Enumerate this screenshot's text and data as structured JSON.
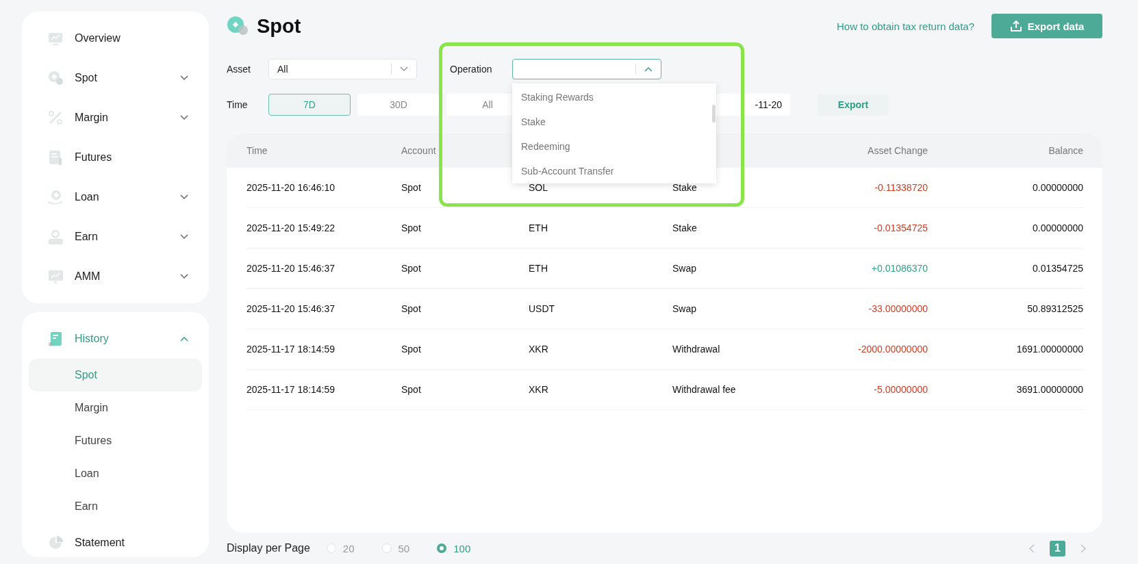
{
  "sidebar": {
    "groups": [
      {
        "items": [
          {
            "label": "Overview",
            "kind": "link",
            "active": false
          },
          {
            "label": "Spot",
            "kind": "menu",
            "expanded": false,
            "active": false
          },
          {
            "label": "Margin",
            "kind": "menu",
            "expanded": false,
            "active": false
          },
          {
            "label": "Futures",
            "kind": "link",
            "active": false
          },
          {
            "label": "Loan",
            "kind": "menu",
            "expanded": false,
            "active": false
          },
          {
            "label": "Earn",
            "kind": "menu",
            "expanded": false,
            "active": false
          },
          {
            "label": "AMM",
            "kind": "menu",
            "expanded": false,
            "active": false
          }
        ]
      },
      {
        "items": [
          {
            "label": "History",
            "kind": "menu",
            "expanded": true,
            "active": true,
            "children": [
              {
                "label": "Spot",
                "selected": true
              },
              {
                "label": "Margin",
                "selected": false
              },
              {
                "label": "Futures",
                "selected": false
              },
              {
                "label": "Loan",
                "selected": false
              },
              {
                "label": "Earn",
                "selected": false
              }
            ]
          },
          {
            "label": "Statement",
            "kind": "link",
            "active": false
          }
        ]
      }
    ]
  },
  "header": {
    "title": "Spot",
    "help_link": "How to obtain tax return data?",
    "export_button": "Export data"
  },
  "filters": {
    "asset": {
      "label": "Asset",
      "value": "All",
      "open": false
    },
    "operation": {
      "label": "Operation",
      "open": true,
      "options": [
        "Staking Rewards",
        "Stake",
        "Redeeming",
        "Sub-Account Transfer"
      ]
    },
    "time": {
      "label": "Time",
      "presets": [
        {
          "label": "7D",
          "selected": true
        },
        {
          "label": "30D",
          "selected": false
        },
        {
          "label": "All",
          "selected": false
        }
      ],
      "date_range": "-11-20",
      "export_button": "Export"
    }
  },
  "table": {
    "columns": {
      "time": "Time",
      "account": "Account",
      "asset_change": "Asset Change",
      "balance": "Balance"
    },
    "rows": [
      {
        "time": "2025-11-20 16:46:10",
        "account": "Spot",
        "asset": "SOL",
        "operation": "Stake",
        "change": "-0.11338720",
        "color": "#d13b22",
        "balance": "0.00000000"
      },
      {
        "time": "2025-11-20 15:49:22",
        "account": "Spot",
        "asset": "ETH",
        "operation": "Stake",
        "change": "-0.01354725",
        "color": "#d13b22",
        "balance": "0.00000000"
      },
      {
        "time": "2025-11-20 15:46:37",
        "account": "Spot",
        "asset": "ETH",
        "operation": "Swap",
        "change": "+0.01086370",
        "color": "#2e9e86",
        "balance": "0.01354725"
      },
      {
        "time": "2025-11-20 15:46:37",
        "account": "Spot",
        "asset": "USDT",
        "operation": "Swap",
        "change": "-33.00000000",
        "color": "#d13b22",
        "balance": "50.89312525"
      },
      {
        "time": "2025-11-17 18:14:59",
        "account": "Spot",
        "asset": "XKR",
        "operation": "Withdrawal",
        "change": "-2000.00000000",
        "color": "#d13b22",
        "balance": "1691.00000000"
      },
      {
        "time": "2025-11-17 18:14:59",
        "account": "Spot",
        "asset": "XKR",
        "operation": "Withdrawal fee",
        "change": "-5.00000000",
        "color": "#d13b22",
        "balance": "3691.00000000"
      }
    ]
  },
  "footer": {
    "per_page": {
      "label": "Display per Page",
      "options": [
        {
          "label": "20",
          "selected": false
        },
        {
          "label": "50",
          "selected": false
        },
        {
          "label": "100",
          "selected": true
        }
      ]
    },
    "pagination": {
      "pages": [
        {
          "label": "1",
          "selected": true
        }
      ]
    }
  }
}
